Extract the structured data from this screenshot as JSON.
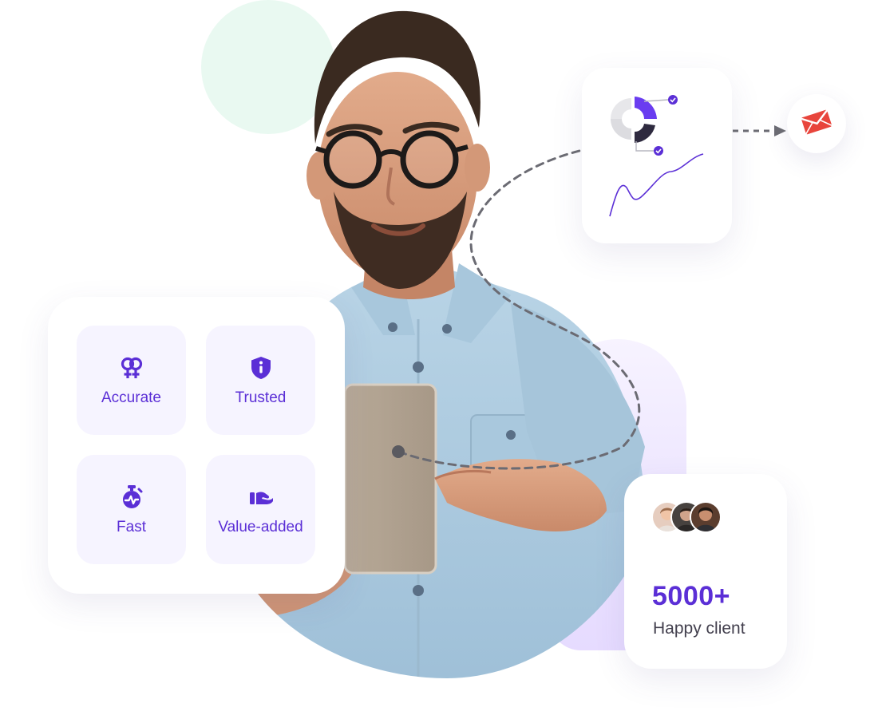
{
  "features": [
    {
      "label": "Accurate",
      "icon": "gender-symbols-icon"
    },
    {
      "label": "Trusted",
      "icon": "shield-info-icon"
    },
    {
      "label": "Fast",
      "icon": "stopwatch-icon"
    },
    {
      "label": "Value-added",
      "icon": "hand-giving-icon"
    }
  ],
  "clients": {
    "count": "5000+",
    "label": "Happy client"
  },
  "colors": {
    "accent": "#5b2fd6",
    "tile_bg": "#f6f4ff",
    "mint": "#e9f9f1",
    "mail_red": "#e8453c",
    "dash_gray": "#6b6b73"
  }
}
